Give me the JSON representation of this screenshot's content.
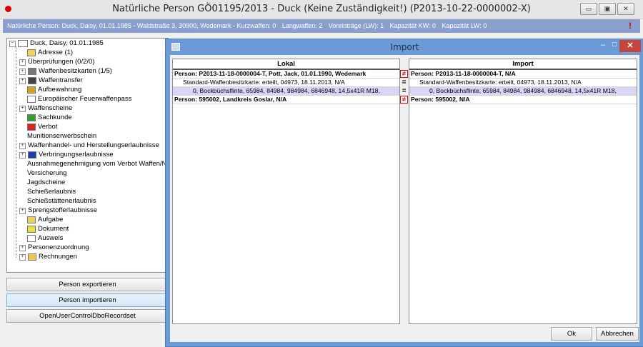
{
  "main": {
    "title": "Natürliche Person GÖ01195/2013 - Duck (Keine Zuständigkeit!) (P2013-10-22-0000002-X)",
    "window_buttons": [
      "▭",
      "▣",
      "✕"
    ],
    "infobar": {
      "segments": [
        "Natürliche Person: Duck, Daisy, 01.01.1985 - Waldstraße 3, 30900, Wedemark - Kurzwaffen: 0",
        "Langwaffen: 2",
        "Voreinträge (LW): 1",
        "Kapazität KW: 0",
        "Kapazität LW: 0"
      ],
      "alert": "!"
    }
  },
  "tree": {
    "root": "Duck, Daisy, 01.01.1985",
    "items": [
      {
        "label": "Adresse (1)",
        "expander": "",
        "icon": "envelope-icon",
        "color": "#f0d060"
      },
      {
        "label": "Überprüfungen (0/2/0)",
        "expander": "+",
        "icon": "",
        "color": ""
      },
      {
        "label": "Waffenbesitzkarten (1/5)",
        "expander": "+",
        "icon": "pistol-icon",
        "color": "#777777"
      },
      {
        "label": "Waffentransfer",
        "expander": "+",
        "icon": "transfer-icon",
        "color": "#444444"
      },
      {
        "label": "Aufbewahrung",
        "expander": "",
        "icon": "house-icon",
        "color": "#d9a020"
      },
      {
        "label": "Europäischer Feuerwaffenpass",
        "expander": "",
        "icon": "card-icon",
        "color": "#ffffff"
      },
      {
        "label": "Waffenscheine",
        "expander": "+",
        "icon": "",
        "color": ""
      },
      {
        "label": "Sachkunde",
        "expander": "",
        "icon": "flag-icon",
        "color": "#2ea02e"
      },
      {
        "label": "Verbot",
        "expander": "",
        "icon": "forbidden-icon",
        "color": "#e02020"
      },
      {
        "label": "Munitionserwerbschein",
        "expander": "",
        "icon": "",
        "color": ""
      },
      {
        "label": "Waffenhandel- und Herstellungserlaubnisse",
        "expander": "+",
        "icon": "",
        "color": ""
      },
      {
        "label": "Verbringungserlaubnisse",
        "expander": "+",
        "icon": "eu-flag-icon",
        "color": "#1a3fb0"
      },
      {
        "label": "Ausnahmegenehmigung vom Verbot Waffen/N",
        "expander": "",
        "icon": "",
        "color": ""
      },
      {
        "label": "Versicherung",
        "expander": "",
        "icon": "",
        "color": ""
      },
      {
        "label": "Jagdscheine",
        "expander": "",
        "icon": "",
        "color": ""
      },
      {
        "label": "Schießerlaubnis",
        "expander": "",
        "icon": "",
        "color": ""
      },
      {
        "label": "Schießstättenerlaubnis",
        "expander": "",
        "icon": "",
        "color": ""
      },
      {
        "label": "Sprengstofferlaubnisse",
        "expander": "+",
        "icon": "",
        "color": ""
      },
      {
        "label": "Aufgabe",
        "expander": "",
        "icon": "task-icon",
        "color": "#f0d060"
      },
      {
        "label": "Dokument",
        "expander": "",
        "icon": "document-icon",
        "color": "#e8e040"
      },
      {
        "label": "Ausweis",
        "expander": "",
        "icon": "id-card-icon",
        "color": "#ffffff"
      },
      {
        "label": "Personenzuordnung",
        "expander": "+",
        "icon": "",
        "color": ""
      },
      {
        "label": "Rechnungen",
        "expander": "+",
        "icon": "folder-icon",
        "color": "#f0c850"
      }
    ]
  },
  "side_buttons": [
    {
      "label": "Person exportieren",
      "active": false
    },
    {
      "label": "Person importieren",
      "active": true
    },
    {
      "label": "OpenUserControlDboRecordset",
      "active": false
    }
  ],
  "dialog": {
    "title": "Import",
    "minimize": "–",
    "maximize": "□",
    "close": "✕",
    "left_header": "Lokal",
    "right_header": "Import",
    "left_rows": [
      {
        "text": "Person: P2013-11-18-0000004-T, Pott, Jack, 01.01.1990, Wedemark",
        "style": "bold"
      },
      {
        "text": "Standard-Waffenbesitzkarte: erteilt, 04973, 18.11.2013, N/A",
        "style": "ind1"
      },
      {
        "text": "0, Bockbüchsflinte, 65984, 84984, 984984, 6846948, 14,5x41R M18,",
        "style": "ind2 hl"
      },
      {
        "text": "Person: 595002, Landkreis Goslar, N/A",
        "style": "bold"
      }
    ],
    "right_rows": [
      {
        "text": "Person: P2013-11-18-0000004-T, N/A",
        "style": "bold"
      },
      {
        "text": "Standard-Waffenbesitzkarte: erteilt, 04973, 18.11.2013, N/A",
        "style": "ind1"
      },
      {
        "text": "0, Bockbüchsflinte, 65984, 84984, 984984, 6846948, 14,5x41R M18,",
        "style": "ind2 hl"
      },
      {
        "text": "Person: 595002, N/A",
        "style": "bold"
      }
    ],
    "markers": [
      "not-equal",
      "equal",
      "equal",
      "not-equal"
    ],
    "ok_label": "Ok",
    "cancel_label": "Abbrechen"
  },
  "colors": {
    "infobar": "#8b9fcf",
    "dialog_frame": "#6b9ad6",
    "close_button": "#c7463b",
    "highlight_row": "#d6d7f5",
    "diff_marker": "#e00000"
  }
}
